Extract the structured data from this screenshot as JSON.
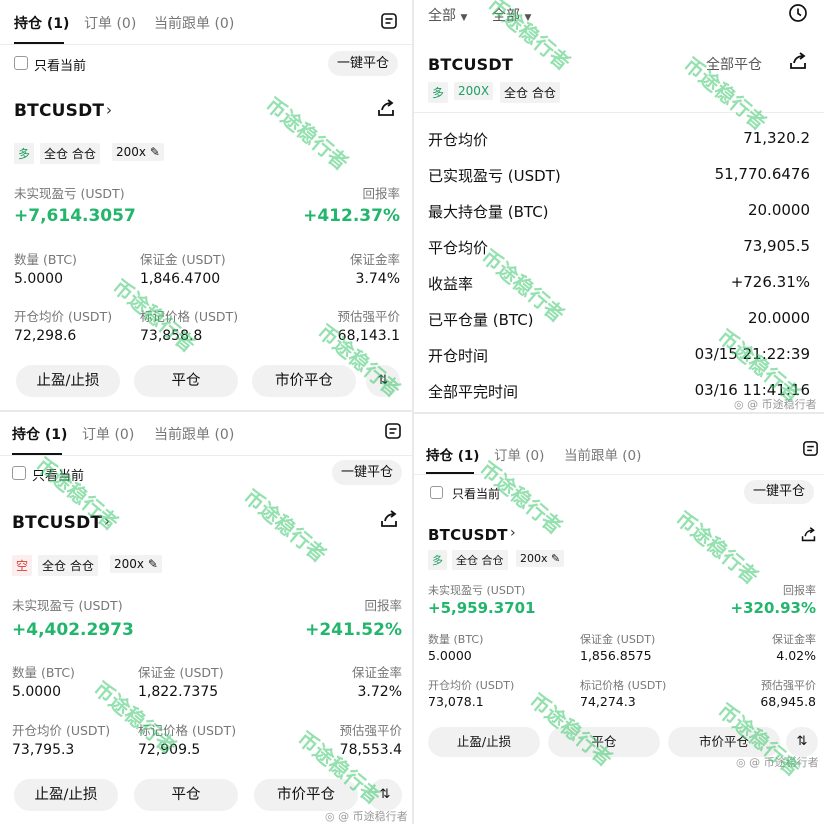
{
  "watermark_text": "币途稳行者",
  "weibo_watermark": "@ 币途稳行者",
  "p1": {
    "tabs": [
      "持仓 (1)",
      "订单 (0)",
      "当前跟单 (0)"
    ],
    "only_current": "只看当前",
    "close_all": "一键平仓",
    "symbol": "BTCUSDT",
    "tags": {
      "side": "多",
      "mode": "全仓 合仓",
      "leverage": "200x"
    },
    "pnl_label": "未实现盈亏 (USDT)",
    "pnl_value": "+7,614.3057",
    "roe_label": "回报率",
    "roe_value": "+412.37%",
    "qty_label": "数量 (BTC)",
    "qty_value": "5.0000",
    "margin_label": "保证金 (USDT)",
    "margin_value": "1,846.4700",
    "mratio_label": "保证金率",
    "mratio_value": "3.74%",
    "entry_label": "开仓均价 (USDT)",
    "entry_value": "72,298.6",
    "mark_label": "标记价格 (USDT)",
    "mark_value": "73,858.8",
    "liq_label": "预估强平价",
    "liq_value": "68,143.1",
    "btn_tpsl": "止盈/止损",
    "btn_close": "平仓",
    "btn_market_close": "市价平仓"
  },
  "p2": {
    "tabs": [
      "持仓 (1)",
      "订单 (0)",
      "当前跟单 (0)"
    ],
    "only_current": "只看当前",
    "close_all": "一键平仓",
    "symbol": "BTCUSDT",
    "tags": {
      "side": "空",
      "mode": "全仓 合仓",
      "leverage": "200x"
    },
    "pnl_label": "未实现盈亏 (USDT)",
    "pnl_value": "+4,402.2973",
    "roe_label": "回报率",
    "roe_value": "+241.52%",
    "qty_label": "数量 (BTC)",
    "qty_value": "5.0000",
    "margin_label": "保证金 (USDT)",
    "margin_value": "1,822.7375",
    "mratio_label": "保证金率",
    "mratio_value": "3.72%",
    "entry_label": "开仓均价 (USDT)",
    "entry_value": "73,795.3",
    "mark_label": "标记价格 (USDT)",
    "mark_value": "72,909.5",
    "liq_label": "预估强平价",
    "liq_value": "78,553.4",
    "btn_tpsl": "止盈/止损",
    "btn_close": "平仓",
    "btn_market_close": "市价平仓"
  },
  "p3": {
    "filter1": "全部",
    "filter2": "全部",
    "symbol": "BTCUSDT",
    "close_all_label": "全部平仓",
    "tags": {
      "side": "多",
      "leverage": "200X",
      "mode": "全仓 合仓"
    },
    "rows": [
      {
        "label": "开仓均价",
        "value": "71,320.2"
      },
      {
        "label": "已实现盈亏 (USDT)",
        "value": "51,770.6476"
      },
      {
        "label": "最大持仓量 (BTC)",
        "value": "20.0000"
      },
      {
        "label": "平仓均价",
        "value": "73,905.5"
      },
      {
        "label": "收益率",
        "value": "+726.31%"
      },
      {
        "label": "已平仓量 (BTC)",
        "value": "20.0000"
      },
      {
        "label": "开仓时间",
        "value": "03/15 21:22:39"
      },
      {
        "label": "全部平完时间",
        "value": "03/16 11:41:16"
      }
    ]
  },
  "p4": {
    "tabs": [
      "持仓 (1)",
      "订单 (0)",
      "当前跟单 (0)"
    ],
    "only_current": "只看当前",
    "close_all": "一键平仓",
    "symbol": "BTCUSDT",
    "tags": {
      "side": "多",
      "mode": "全仓 合仓",
      "leverage": "200x"
    },
    "pnl_label": "未实现盈亏 (USDT)",
    "pnl_value": "+5,959.3701",
    "roe_label": "回报率",
    "roe_value": "+320.93%",
    "qty_label": "数量 (BTC)",
    "qty_value": "5.0000",
    "margin_label": "保证金 (USDT)",
    "margin_value": "1,856.8575",
    "mratio_label": "保证金率",
    "mratio_value": "4.02%",
    "entry_label": "开仓均价 (USDT)",
    "entry_value": "73,078.1",
    "mark_label": "标记价格 (USDT)",
    "mark_value": "74,274.3",
    "liq_label": "预估强平价",
    "liq_value": "68,945.8",
    "btn_tpsl": "止盈/止损",
    "btn_close": "平仓",
    "btn_market_close": "市价平仓"
  },
  "colors": {
    "profit_green": "#22b56c",
    "short_red": "#d9433d",
    "watermark_green": "#3cc86e"
  }
}
